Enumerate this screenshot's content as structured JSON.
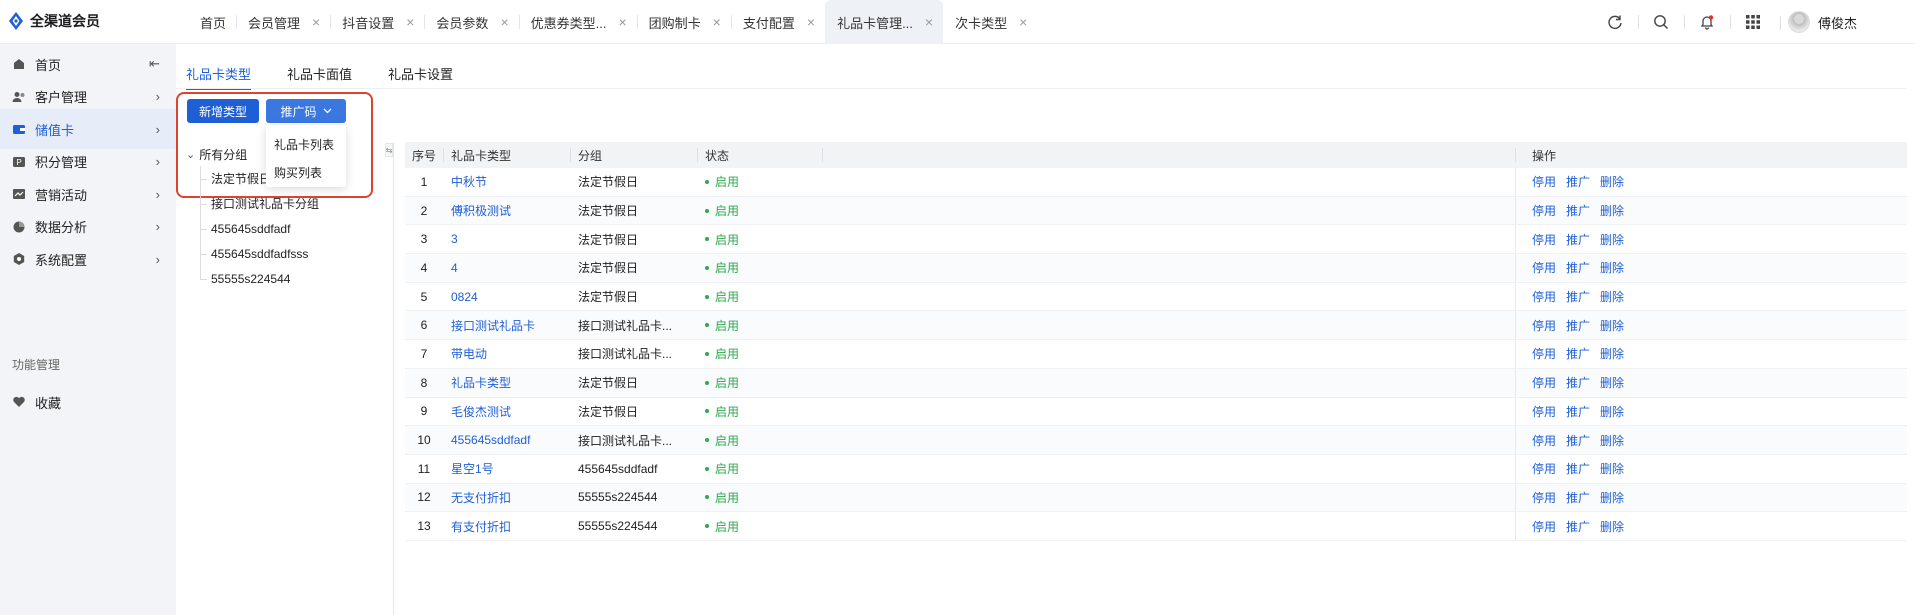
{
  "app": {
    "name": "全渠道会员",
    "tabs": [
      {
        "label": "首页",
        "closable": false
      },
      {
        "label": "会员管理",
        "closable": true
      },
      {
        "label": "抖音设置",
        "closable": true
      },
      {
        "label": "会员参数",
        "closable": true
      },
      {
        "label": "优惠券类型...",
        "closable": true
      },
      {
        "label": "团购制卡",
        "closable": true
      },
      {
        "label": "支付配置",
        "closable": true
      },
      {
        "label": "礼品卡管理...",
        "closable": true,
        "active": true
      },
      {
        "label": "次卡类型",
        "closable": true
      }
    ],
    "close_glyph": "×",
    "user_name": "傅俊杰"
  },
  "sidebar": {
    "items": [
      {
        "label": "首页",
        "icon": "home-icon",
        "arrow": "⇤"
      },
      {
        "label": "客户管理",
        "icon": "users-icon",
        "arrow": "›"
      },
      {
        "label": "储值卡",
        "icon": "wallet-icon",
        "arrow": "›",
        "active": true
      },
      {
        "label": "积分管理",
        "icon": "points-icon",
        "arrow": "›"
      },
      {
        "label": "营销活动",
        "icon": "marketing-icon",
        "arrow": "›"
      },
      {
        "label": "数据分析",
        "icon": "pie-chart-icon",
        "arrow": "›"
      },
      {
        "label": "系统配置",
        "icon": "settings-icon",
        "arrow": "›"
      }
    ],
    "section_title": "功能管理",
    "favorites": {
      "label": "收藏",
      "icon": "heart-icon"
    }
  },
  "subtabs": [
    {
      "label": "礼品卡类型",
      "active": true
    },
    {
      "label": "礼品卡面值"
    },
    {
      "label": "礼品卡设置"
    }
  ],
  "toolbar": {
    "add_type_label": "新增类型",
    "promo_code_label": "推广码",
    "promo_menu": [
      "礼品卡列表",
      "购买列表"
    ]
  },
  "tree": {
    "root": "所有分组",
    "nodes": [
      "法定节假日",
      "接口测试礼品卡分组",
      "455645sddfadf",
      "455645sddfadfsss",
      "55555s224544"
    ]
  },
  "table": {
    "columns": {
      "seq": "序号",
      "name": "礼品卡类型",
      "group": "分组",
      "status": "状态",
      "ops": "操作"
    },
    "actions": [
      "停用",
      "推广",
      "删除"
    ],
    "rows": [
      {
        "seq": "1",
        "name": "中秋节",
        "group": "法定节假日",
        "status": "启用"
      },
      {
        "seq": "2",
        "name": "傅积极测试",
        "group": "法定节假日",
        "status": "启用"
      },
      {
        "seq": "3",
        "name": "3",
        "group": "法定节假日",
        "status": "启用"
      },
      {
        "seq": "4",
        "name": "4",
        "group": "法定节假日",
        "status": "启用"
      },
      {
        "seq": "5",
        "name": "0824",
        "group": "法定节假日",
        "status": "启用"
      },
      {
        "seq": "6",
        "name": "接口测试礼品卡",
        "group": "接口测试礼品卡...",
        "status": "启用"
      },
      {
        "seq": "7",
        "name": "带电动",
        "group": "接口测试礼品卡...",
        "status": "启用"
      },
      {
        "seq": "8",
        "name": "礼品卡类型",
        "group": "法定节假日",
        "status": "启用"
      },
      {
        "seq": "9",
        "name": "毛俊杰测试",
        "group": "法定节假日",
        "status": "启用"
      },
      {
        "seq": "10",
        "name": "455645sddfadf",
        "group": "接口测试礼品卡...",
        "status": "启用"
      },
      {
        "seq": "11",
        "name": "星空1号",
        "group": "455645sddfadf",
        "status": "启用"
      },
      {
        "seq": "12",
        "name": "无支付折扣",
        "group": "55555s224544",
        "status": "启用"
      },
      {
        "seq": "13",
        "name": "有支付折扣",
        "group": "55555s224544",
        "status": "启用"
      }
    ]
  },
  "colors": {
    "accent": "#1f5fd6",
    "status_ok": "#2fa84f",
    "highlight": "#e0432b"
  }
}
